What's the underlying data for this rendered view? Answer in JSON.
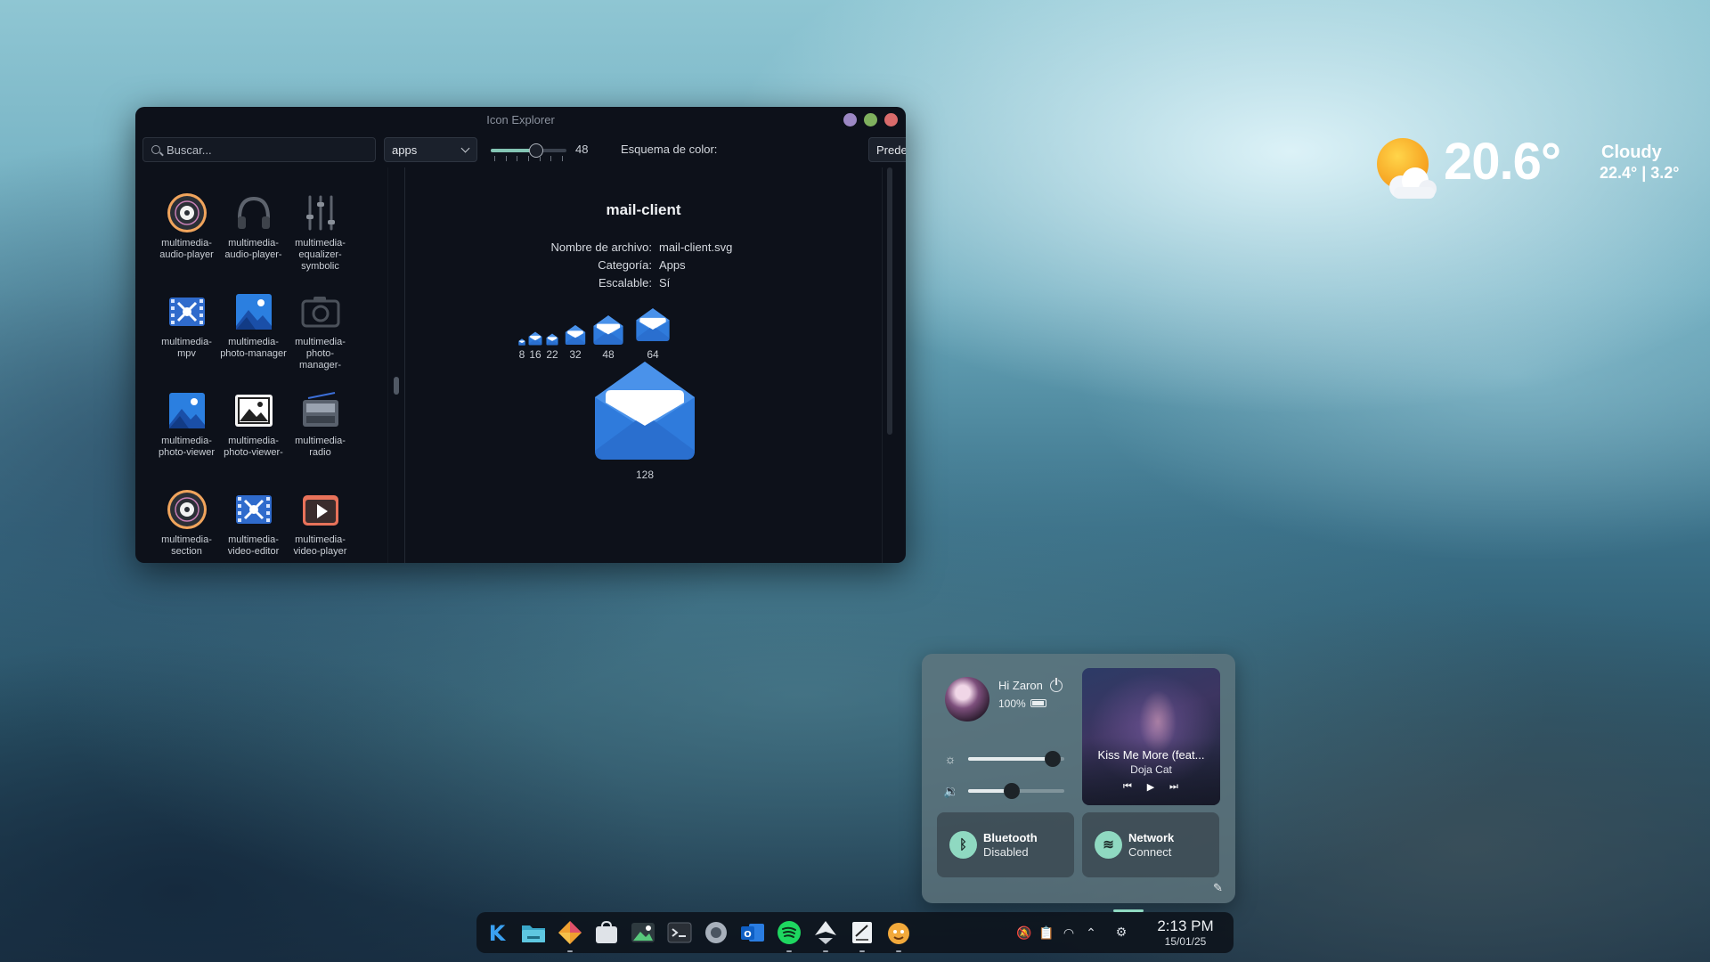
{
  "window": {
    "title": "Icon Explorer",
    "search_placeholder": "Buscar...",
    "category": "apps",
    "icon_size": "48",
    "icon_size_fraction": 0.6,
    "color_scheme_label": "Esquema de color:",
    "color_scheme": "Predeterminado"
  },
  "icons": [
    {
      "label": "multimedia-audio-player",
      "icon": "vinyl-disc-icon"
    },
    {
      "label": "multimedia-audio-player-",
      "icon": "headphones-icon"
    },
    {
      "label": "multimedia-equalizer-symbolic",
      "icon": "equalizer-icon"
    },
    {
      "label": "multimedia-mpv",
      "icon": "film-reel-icon"
    },
    {
      "label": "multimedia-photo-manager",
      "icon": "mountain-photo-icon"
    },
    {
      "label": "multimedia-photo-manager-",
      "icon": "camera-icon"
    },
    {
      "label": "multimedia-photo-viewer",
      "icon": "mountain-photo-icon"
    },
    {
      "label": "multimedia-photo-viewer-",
      "icon": "picture-frame-icon"
    },
    {
      "label": "multimedia-radio",
      "icon": "radio-icon"
    },
    {
      "label": "multimedia-section",
      "icon": "vinyl-disc-icon"
    },
    {
      "label": "multimedia-video-editor",
      "icon": "film-reel-icon"
    },
    {
      "label": "multimedia-video-player",
      "icon": "play-clapper-icon"
    }
  ],
  "detail": {
    "name": "mail-client",
    "filename_label": "Nombre de archivo:",
    "filename": "mail-client.svg",
    "category_label": "Categoría:",
    "category": "Apps",
    "scalable_label": "Escalable:",
    "scalable": "Sí",
    "sizes": [
      "8",
      "16",
      "22",
      "32",
      "48",
      "64"
    ],
    "big_size": "128",
    "icon": "mail-envelope-icon"
  },
  "weather": {
    "temp": "20.6°",
    "condition": "Cloudy",
    "range": "22.4° | 3.2°",
    "icon": "sun-cloud-icon"
  },
  "quick_settings": {
    "greeting": "Hi Zaron",
    "battery": "100%",
    "brightness_fraction": 0.88,
    "volume_fraction": 0.45,
    "media": {
      "song": "Kiss Me More (feat...",
      "artist": "Doja Cat"
    },
    "bluetooth": {
      "name": "Bluetooth",
      "status": "Disabled"
    },
    "network": {
      "name": "Network",
      "status": "Connect"
    }
  },
  "taskbar": {
    "apps": [
      "kde-launcher-icon",
      "file-manager-icon",
      "git-icon",
      "discover-store-icon",
      "image-viewer-icon",
      "terminal-icon",
      "settings-icon",
      "outlook-icon",
      "spotify-icon",
      "inkscape-icon",
      "notes-icon",
      "avatar-app-icon"
    ],
    "time": "2:13 PM",
    "date": "15/01/25"
  },
  "colors": {
    "accent": "#84c5b4",
    "window_bg": "#0d111a",
    "mail_blue": "#2f7bdc"
  }
}
